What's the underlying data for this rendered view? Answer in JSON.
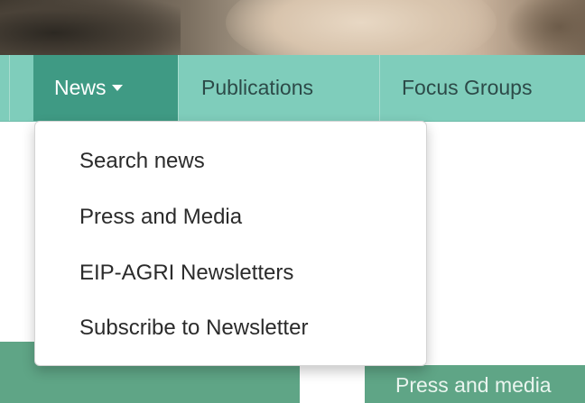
{
  "navbar": {
    "items": [
      {
        "label": "News"
      },
      {
        "label": "Publications"
      },
      {
        "label": "Focus Groups"
      }
    ]
  },
  "dropdown": {
    "items": [
      {
        "label": "Search news"
      },
      {
        "label": "Press and Media"
      },
      {
        "label": "EIP-AGRI Newsletters"
      },
      {
        "label": "Subscribe to Newsletter"
      }
    ]
  },
  "panels": {
    "right_label": "Press and media"
  },
  "colors": {
    "navbar_bg": "#7fcdbb",
    "active_tab_bg": "#3f9a84",
    "panel_bg": "#5fa586"
  },
  "icons": {
    "dropdown_caret": "caret-down-icon"
  }
}
